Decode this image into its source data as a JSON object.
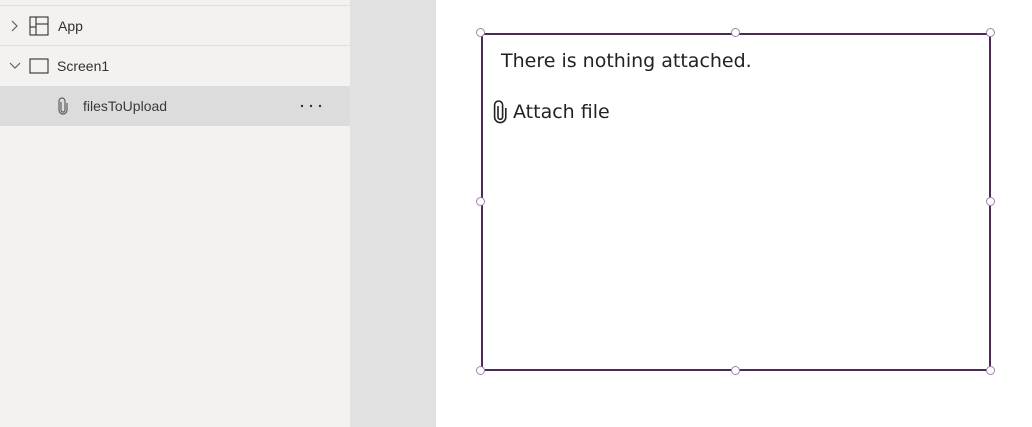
{
  "tree_view": {
    "items": [
      {
        "label": "App",
        "expanded": false,
        "icon": "app-icon",
        "chevron": "chevron-right-icon"
      },
      {
        "label": "Screen1",
        "expanded": true,
        "icon": "screen-icon",
        "chevron": "chevron-down-icon"
      },
      {
        "label": "filesToUpload",
        "selected": true,
        "icon": "paperclip-icon",
        "more": "more-options-icon"
      }
    ]
  },
  "canvas": {
    "attachments_control": {
      "empty_text": "There is nothing attached.",
      "attach_label": "Attach file",
      "attach_icon": "paperclip-icon"
    }
  },
  "colors": {
    "tree_background": "#f3f2f1",
    "tree_selected": "#dcdcdc",
    "gutter": "#e1e1e1",
    "selection_border": "#4c2a55",
    "handle_border": "#a77fb2"
  }
}
